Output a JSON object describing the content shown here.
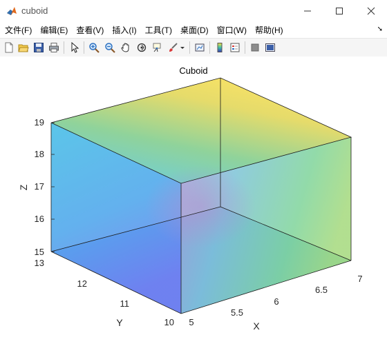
{
  "window": {
    "title": "cuboid"
  },
  "menu": [
    "文件(F)",
    "编辑(E)",
    "查看(V)",
    "插入(I)",
    "工具(T)",
    "桌面(D)",
    "窗口(W)",
    "帮助(H)"
  ],
  "toolbar": {
    "icons": [
      "new-figure-icon",
      "open-file-icon",
      "save-icon",
      "print-icon",
      "pointer-icon",
      "zoom-in-icon",
      "zoom-out-icon",
      "pan-icon",
      "rotate-3d-icon",
      "data-cursor-icon",
      "brush-icon",
      "link-plot-icon",
      "colorbar-icon",
      "legend-icon",
      "hide-plot-tools-icon",
      "show-plot-tools-icon"
    ]
  },
  "axes": {
    "title": "Cuboid",
    "xlabel": "X",
    "ylabel": "Y",
    "zlabel": "Z",
    "x_ticks": [
      "5",
      "5.5",
      "6",
      "6.5",
      "7"
    ],
    "y_ticks": [
      "10",
      "11",
      "12",
      "13"
    ],
    "z_ticks": [
      "15",
      "16",
      "17",
      "18",
      "19"
    ]
  },
  "chart_data": {
    "type": "surface",
    "title": "Cuboid",
    "xlabel": "X",
    "ylabel": "Y",
    "zlabel": "Z",
    "xlim": [
      5,
      7
    ],
    "ylim": [
      10,
      13
    ],
    "zlim": [
      15,
      19
    ],
    "x_ticks": [
      5,
      5.5,
      6,
      6.5,
      7
    ],
    "y_ticks": [
      10,
      11,
      12,
      13
    ],
    "z_ticks": [
      15,
      16,
      17,
      18,
      19
    ],
    "colormap": "parula",
    "face_alpha": "semi-transparent",
    "grid": false
  }
}
